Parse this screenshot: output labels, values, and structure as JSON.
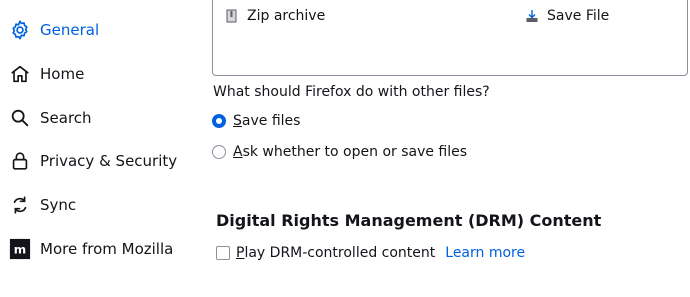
{
  "sidebar": {
    "items": [
      {
        "label": "General",
        "icon": "gear-icon",
        "selected": true
      },
      {
        "label": "Home",
        "icon": "home-icon"
      },
      {
        "label": "Search",
        "icon": "search-icon"
      },
      {
        "label": "Privacy & Security",
        "icon": "lock-icon"
      },
      {
        "label": "Sync",
        "icon": "sync-icon"
      },
      {
        "label": "More from Mozilla",
        "icon": "mozilla-logo-icon"
      }
    ]
  },
  "applications": {
    "row": {
      "content_type": "Zip archive",
      "action": "Save File"
    },
    "question": "What should Firefox do with other files?",
    "options": [
      {
        "label_accel": "S",
        "label_rest": "ave files",
        "checked": true
      },
      {
        "label_accel": "A",
        "label_rest": "sk whether to open or save files",
        "checked": false
      }
    ]
  },
  "drm": {
    "title": "Digital Rights Management (DRM) Content",
    "checkbox_accel": "P",
    "checkbox_rest": "lay DRM-controlled content",
    "checked": false,
    "learn_more": "Learn more"
  },
  "colors": {
    "accent": "#0061e0",
    "text": "#15141a",
    "border": "#8f8f9d"
  }
}
